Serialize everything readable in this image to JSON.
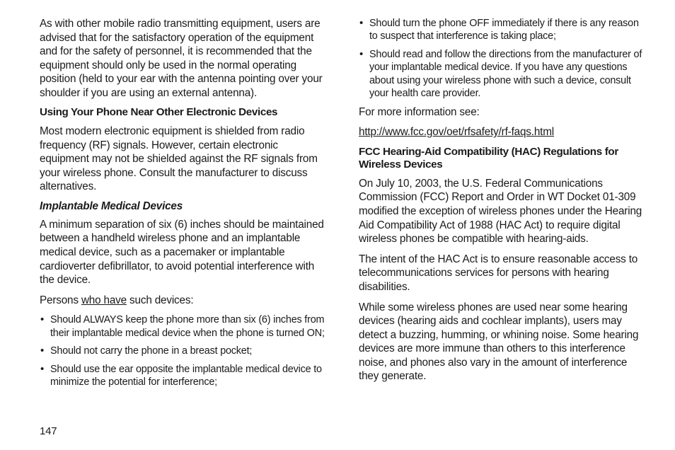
{
  "left": {
    "intro": "As with other mobile radio transmitting equipment, users are advised that for the satisfactory operation of the equipment and for the safety of personnel, it is recommended that the equipment should only be used in the normal operating position (held to your ear with the antenna pointing over your shoulder if you are using an external antenna).",
    "h1": "Using Your Phone Near Other Electronic Devices",
    "p1": "Most modern electronic equipment is shielded from radio frequency (RF) signals. However, certain electronic equipment may not be shielded against the RF signals from your wireless phone. Consult the manufacturer to discuss alternatives.",
    "sub": "Implantable Medical Devices",
    "p2": "A minimum separation of six (6) inches should be maintained between a handheld wireless phone and an implantable medical device, such as a pacemaker or implantable cardioverter defibrillator, to avoid potential interference with the device.",
    "p3_pre": "Persons ",
    "p3_u": "who have",
    "p3_post": " such devices:",
    "bullets": [
      "Should ALWAYS keep the phone more than six (6) inches from their implantable medical device when the phone is turned ON;",
      "Should not carry the phone in a breast pocket;",
      "Should use the ear opposite the implantable medical device to minimize the potential for interference;"
    ]
  },
  "right": {
    "bullets": [
      "Should turn the phone OFF immediately if there is any reason to suspect that interference is taking place;",
      "Should read and follow the directions from the manufacturer of your implantable medical device. If you have any questions about using your wireless phone with such a device, consult your health care provider."
    ],
    "moreinfo": "For more information see:",
    "url": "http://www.fcc.gov/oet/rfsafety/rf-faqs.html",
    "h2": "FCC Hearing-Aid Compatibility (HAC) Regulations for Wireless Devices",
    "p1": "On July 10, 2003, the U.S. Federal Communications Commission (FCC) Report and Order in WT Docket 01-309 modified the exception of wireless phones under the Hearing Aid Compatibility Act of 1988 (HAC Act) to require digital wireless phones be compatible with hearing-aids.",
    "p2": "The intent of the HAC Act is to ensure reasonable access to telecommunications services for persons with hearing disabilities.",
    "p3": "While some wireless phones are used near some hearing devices (hearing aids and cochlear implants), users may detect a buzzing, humming, or whining noise. Some hearing devices are more immune than others to this interference noise, and phones also vary in the amount of interference they generate."
  },
  "pageNumber": "147"
}
